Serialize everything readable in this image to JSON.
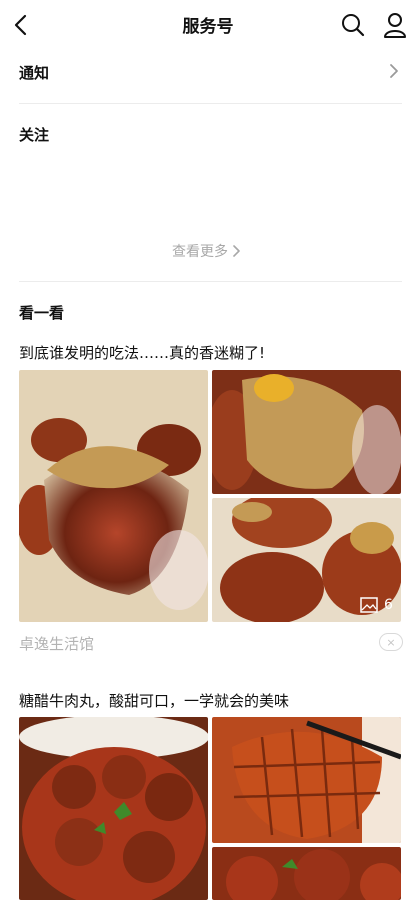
{
  "header": {
    "title": "服务号"
  },
  "sections": {
    "notice_label": "通知",
    "follow_label": "关注",
    "view_more": "查看更多",
    "look_label": "看一看"
  },
  "articles": [
    {
      "title": "到底谁发明的吃法……真的香迷糊了!",
      "source": "卓逸生活馆",
      "image_count": "6",
      "dismiss": "×"
    },
    {
      "title": "糖醋牛肉丸，酸甜可口，一学就会的美味"
    }
  ]
}
